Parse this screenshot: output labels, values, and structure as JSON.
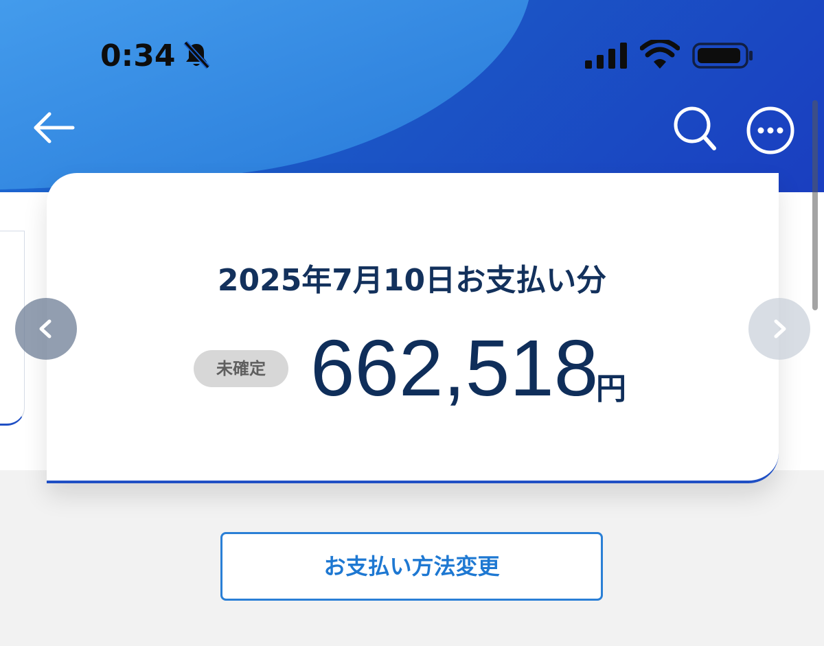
{
  "status_bar": {
    "time": "0:34",
    "bell_icon": "bell-slash-icon",
    "signal_icon": "cellular-signal-icon",
    "wifi_icon": "wifi-icon",
    "battery_icon": "battery-icon"
  },
  "nav": {
    "back_icon": "arrow-left-icon",
    "search_icon": "search-icon",
    "more_icon": "more-horizontal-circle-icon"
  },
  "card": {
    "title": "2025年7月10日お支払い分",
    "status_badge": "未確定",
    "amount": "662,518",
    "unit": "円"
  },
  "carousel": {
    "prev_icon": "chevron-left-icon",
    "next_icon": "chevron-right-icon"
  },
  "actions": {
    "change_payment_label": "お支払い方法変更"
  },
  "colors": {
    "header_blue": "#1b57c6",
    "navy_text": "#13315c",
    "accent_blue": "#1e78d2",
    "badge_gray": "#d7d7d7"
  }
}
